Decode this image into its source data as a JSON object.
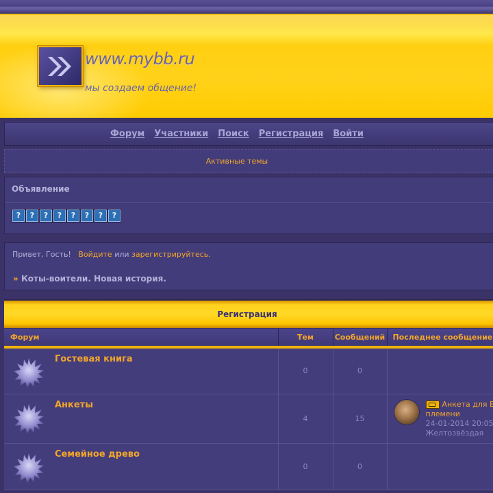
{
  "header": {
    "logo_text": "www.mybb.ru",
    "slogan": "мы создаем общение!"
  },
  "nav": {
    "items": [
      {
        "label": "Форум"
      },
      {
        "label": "Участники"
      },
      {
        "label": "Поиск"
      },
      {
        "label": "Регистрация"
      },
      {
        "label": "Войти"
      }
    ],
    "active_topics": "Активные темы"
  },
  "announcement": {
    "title": "Объявление",
    "icon_glyph": "?"
  },
  "welcome": {
    "greeting": "Привет, Гость!",
    "login_link": "Войдите",
    "or_text": "или",
    "register_link": "зарегистрируйтесь.",
    "breadcrumb_marker": "»",
    "breadcrumb_title": "Коты-воители. Новая история."
  },
  "category": {
    "title": "Регистрация"
  },
  "table": {
    "headers": {
      "forum": "Форум",
      "topics": "Тем",
      "posts": "Сообщений",
      "last_post": "Последнее сообщение"
    },
    "rows": [
      {
        "title": "Гостевая книга",
        "topics": "0",
        "posts": "0"
      },
      {
        "title": "Анкеты",
        "topics": "4",
        "posts": "15",
        "last_post": {
          "title_line1": "Анкета для Е",
          "title_line2": "племени",
          "date": "24-01-2014 20:05",
          "author": "Желтозвёздая"
        }
      },
      {
        "title": "Семейное древо",
        "topics": "0",
        "posts": "0"
      }
    ]
  },
  "colors": {
    "accent": "#f2a62a",
    "background": "#3b3368",
    "banner": "#ffd21a"
  }
}
